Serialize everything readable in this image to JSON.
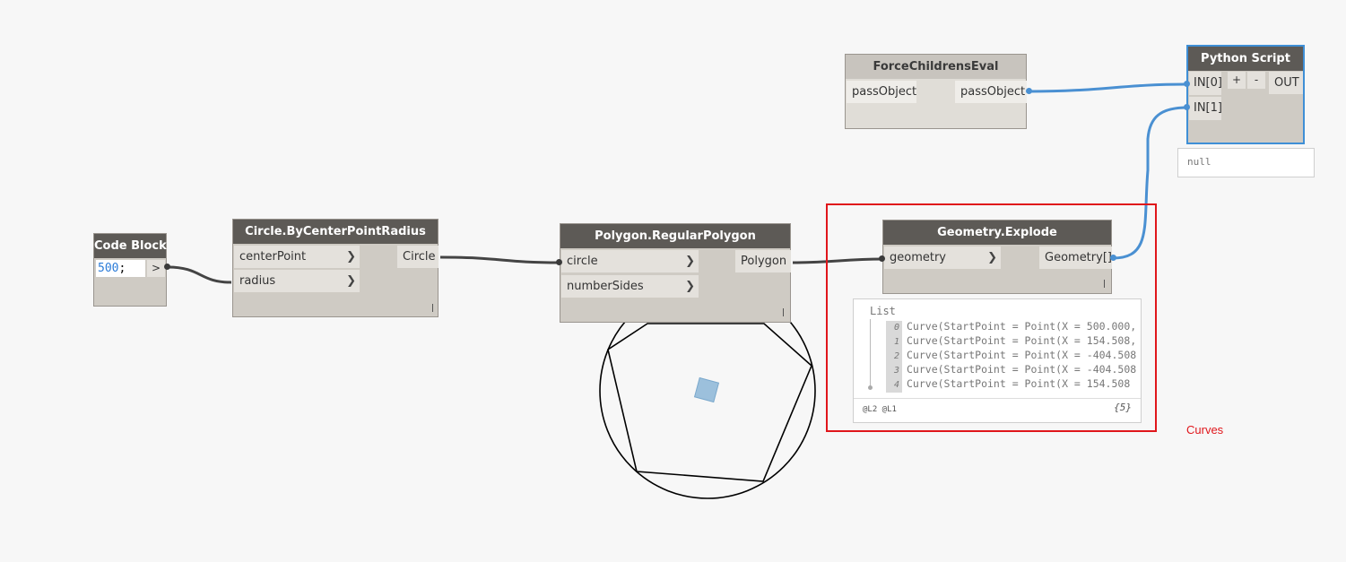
{
  "nodes": {
    "code_block": {
      "title": "Code Block",
      "code_number": "500",
      "code_suffix": ";",
      "output": ">"
    },
    "circle": {
      "title": "Circle.ByCenterPointRadius",
      "in1": "centerPoint",
      "in2": "radius",
      "out": "Circle",
      "lacing": "|"
    },
    "polygon": {
      "title": "Polygon.RegularPolygon",
      "in1": "circle",
      "in2": "numberSides",
      "out": "Polygon",
      "lacing": "|"
    },
    "explode": {
      "title": "Geometry.Explode",
      "in1": "geometry",
      "out": "Geometry[]",
      "lacing": "|"
    },
    "force": {
      "title": "ForceChildrensEval",
      "in1": "passObject",
      "out": "passObject"
    },
    "python": {
      "title": "Python Script",
      "in0": "IN[0]",
      "in1": "IN[1]",
      "plus": "+",
      "minus": "-",
      "out": "OUT"
    }
  },
  "explode_preview": {
    "header": "List",
    "items": [
      {
        "index": "0",
        "text": "Curve(StartPoint = Point(X = 500.000,"
      },
      {
        "index": "1",
        "text": "Curve(StartPoint = Point(X = 154.508,"
      },
      {
        "index": "2",
        "text": "Curve(StartPoint = Point(X = -404.508"
      },
      {
        "index": "3",
        "text": "Curve(StartPoint = Point(X = -404.508"
      },
      {
        "index": "4",
        "text": "Curve(StartPoint = Point(X = 154.508"
      }
    ],
    "levels": "@L2 @L1",
    "count": "{5}"
  },
  "python_preview": {
    "value": "null"
  },
  "annotation": {
    "text": "Curves",
    "color": "#e0161b"
  },
  "colors": {
    "wire": "#444444",
    "wire_selected": "#4a90d2",
    "highlight": "#e0161b"
  }
}
